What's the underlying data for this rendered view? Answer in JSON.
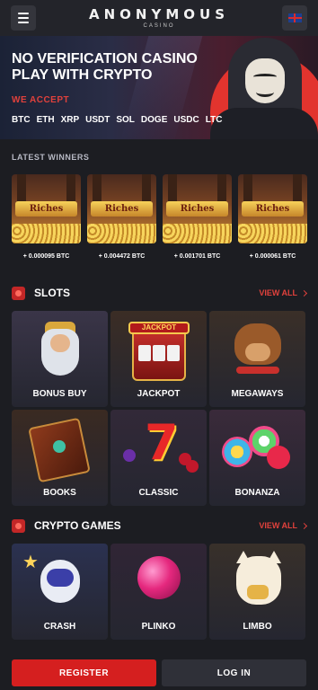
{
  "header": {
    "logo_main": "ANONYMOUS",
    "logo_sub": "CASINO",
    "menu_icon": "hamburger-menu-icon",
    "language_icon": "uk-flag-icon"
  },
  "hero": {
    "title": "NO VERIFICATION CASINO PLAY WITH CRYPTO",
    "accept_label": "WE ACCEPT",
    "coins": [
      "BTC",
      "ETH",
      "XRP",
      "USDT",
      "SOL",
      "DOGE",
      "USDC",
      "LTC"
    ]
  },
  "latest_winners": {
    "title": "LATEST WINNERS",
    "game_art_text": "Riches",
    "items": [
      {
        "amount": "+ 0.000095 BTC"
      },
      {
        "amount": "+ 0.004472 BTC"
      },
      {
        "amount": "+ 0.001701 BTC"
      },
      {
        "amount": "+ 0.000061 BTC"
      }
    ]
  },
  "slots": {
    "title": "SLOTS",
    "view_all": "VIEW ALL",
    "jackpot_sign": "JACKPOT",
    "tiles": [
      "BONUS BUY",
      "JACKPOT",
      "MEGAWAYS",
      "BOOKS",
      "CLASSIC",
      "BONANZA"
    ]
  },
  "crypto_games": {
    "title": "CRYPTO GAMES",
    "view_all": "VIEW ALL",
    "tiles": [
      "CRASH",
      "PLINKO",
      "LIMBO"
    ]
  },
  "footer": {
    "register_label": "REGISTER",
    "login_label": "LOG IN"
  },
  "colors": {
    "accent_red": "#d51f1f",
    "background": "#1c1d22",
    "tile_bg": "#2c2d36"
  }
}
